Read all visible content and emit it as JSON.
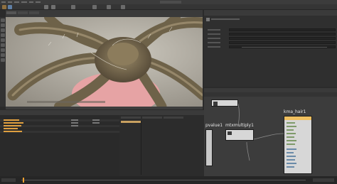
{
  "window": {
    "title": ""
  },
  "network": {
    "nodes": [
      {
        "name": "pvalue1"
      },
      {
        "name": "mtxmultiply1"
      },
      {
        "name": "kma_hair1"
      }
    ]
  },
  "colors": {
    "accent_orange": "#f0a030",
    "node_body": "#d9d9d9",
    "viewport_bg": "#b8b3a8",
    "pink_selection": "#e8a6a8"
  },
  "icons": [
    "shelf-tool-icon",
    "viewport-tool-icon",
    "node-wire-icon"
  ]
}
